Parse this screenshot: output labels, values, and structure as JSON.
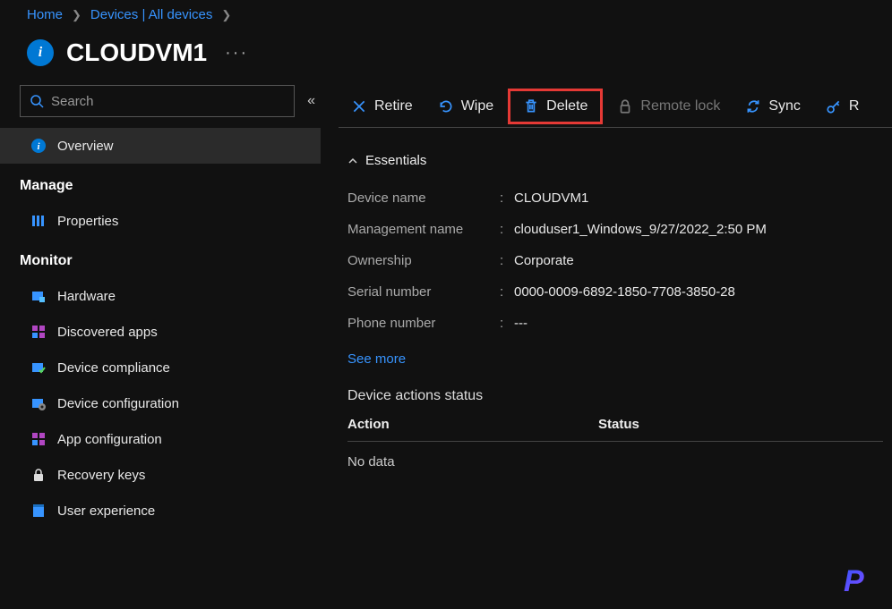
{
  "breadcrumb": {
    "home": "Home",
    "devices": "Devices | All devices"
  },
  "page": {
    "title": "CLOUDVM1"
  },
  "search": {
    "placeholder": "Search"
  },
  "sidebar": {
    "overview": "Overview",
    "manage_header": "Manage",
    "properties": "Properties",
    "monitor_header": "Monitor",
    "hardware": "Hardware",
    "discovered_apps": "Discovered apps",
    "device_compliance": "Device compliance",
    "device_configuration": "Device configuration",
    "app_configuration": "App configuration",
    "recovery_keys": "Recovery keys",
    "user_experience": "User experience"
  },
  "toolbar": {
    "retire": "Retire",
    "wipe": "Wipe",
    "delete": "Delete",
    "remote_lock": "Remote lock",
    "sync": "Sync",
    "reset_extra": "R"
  },
  "essentials": {
    "header": "Essentials",
    "device_name_label": "Device name",
    "device_name_value": "CLOUDVM1",
    "management_name_label": "Management name",
    "management_name_value": "clouduser1_Windows_9/27/2022_2:50 PM",
    "ownership_label": "Ownership",
    "ownership_value": "Corporate",
    "serial_label": "Serial number",
    "serial_value": "0000-0009-6892-1850-7708-3850-28",
    "phone_label": "Phone number",
    "phone_value": "---",
    "see_more": "See more"
  },
  "actions": {
    "title": "Device actions status",
    "col_action": "Action",
    "col_status": "Status",
    "nodata": "No data"
  }
}
